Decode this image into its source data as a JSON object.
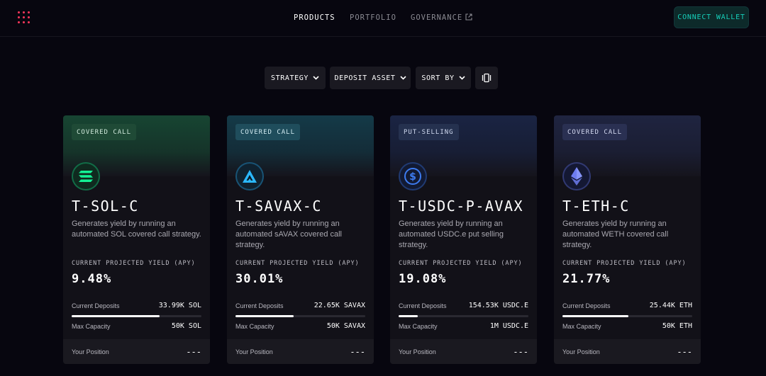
{
  "header": {
    "nav": [
      "PRODUCTS",
      "PORTFOLIO",
      "GOVERNANCE"
    ],
    "connect_label": "CONNECT WALLET",
    "brand_color": "#ff385c",
    "accent_color": "#16ceb9"
  },
  "filters": {
    "strategy": "STRATEGY",
    "deposit_asset": "DEPOSIT ASSET",
    "sort_by": "SORT BY",
    "view_icon": "grid-toggle-icon"
  },
  "labels": {
    "yield": "CURRENT PROJECTED YIELD (APY)",
    "deposits": "Current Deposits",
    "capacity": "Max Capacity",
    "position": "Your Position"
  },
  "cards": [
    {
      "badge": "COVERED CALL",
      "title": "T-SOL-C",
      "desc": "Generates yield by running an automated SOL covered call strategy.",
      "yield": "9.48%",
      "deposits": "33.99K SOL",
      "capacity": "50K SOL",
      "progress": 0.68,
      "position": "---",
      "icon": "solana-icon",
      "color": "#14f195"
    },
    {
      "badge": "COVERED CALL",
      "title": "T-SAVAX-C",
      "desc": "Generates yield by running an automated sAVAX covered call strategy.",
      "yield": "30.01%",
      "deposits": "22.65K SAVAX",
      "capacity": "50K SAVAX",
      "progress": 0.45,
      "position": "---",
      "icon": "savax-icon",
      "color": "#2bb8ff"
    },
    {
      "badge": "PUT-SELLING",
      "title": "T-USDC-P-AVAX",
      "desc": "Generates yield by running an automated USDC.e put selling strategy.",
      "yield": "19.08%",
      "deposits": "154.53K USDC.E",
      "capacity": "1M USDC.E",
      "progress": 0.15,
      "position": "---",
      "icon": "usdc-icon",
      "color": "#3d7bf0"
    },
    {
      "badge": "COVERED CALL",
      "title": "T-ETH-C",
      "desc": "Generates yield by running an automated WETH covered call strategy.",
      "yield": "21.77%",
      "deposits": "25.44K ETH",
      "capacity": "50K ETH",
      "progress": 0.51,
      "position": "---",
      "icon": "ethereum-icon",
      "color": "#6d7cf0"
    }
  ]
}
